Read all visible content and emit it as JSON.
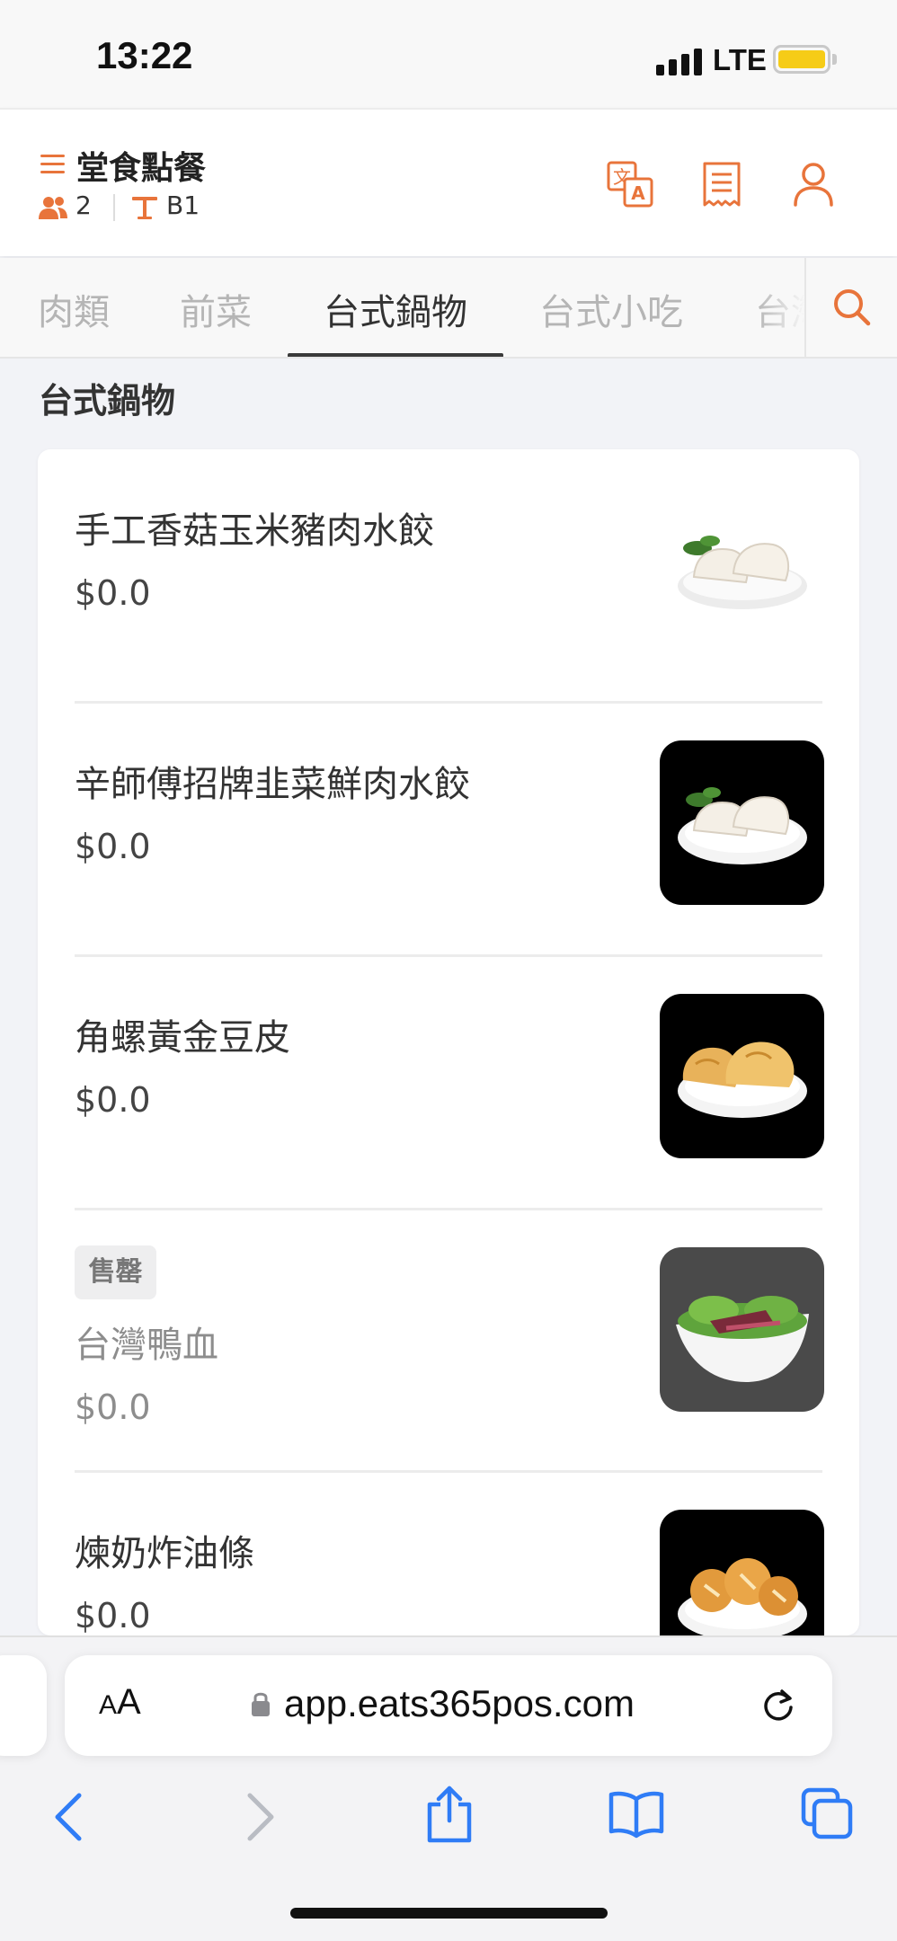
{
  "status_bar": {
    "time": "13:22",
    "network": "LTE"
  },
  "header": {
    "title": "堂食點餐",
    "guest_count": "2",
    "table_label": "B1"
  },
  "category_tabs": [
    "肉類",
    "前菜",
    "台式鍋物",
    "台式小吃",
    "台灣"
  ],
  "active_tab": "台式鍋物",
  "section": {
    "title": "台式鍋物"
  },
  "menu_items": [
    {
      "name": "手工香菇玉米豬肉水餃",
      "price": "$0.0",
      "image": "dumplings-photo",
      "sold_out": false
    },
    {
      "name": "辛師傅招牌韭菜鮮肉水餃",
      "price": "$0.0",
      "image": "dumplings-photo",
      "sold_out": false
    },
    {
      "name": "角螺黃金豆皮",
      "price": "$0.0",
      "image": "fried-tofu-skin-photo",
      "sold_out": false
    },
    {
      "name": "台灣鴨血",
      "price": "$0.0",
      "image": "duck-blood-photo",
      "sold_out": true,
      "badge": "售罄"
    },
    {
      "name": "煉奶炸油條",
      "price": "$0.0",
      "image": "fried-dough-photo",
      "sold_out": false
    }
  ],
  "browser": {
    "aa_small": "A",
    "aa_big": "A",
    "url": "app.eats365pos.com"
  },
  "colors": {
    "accent": "#e8743b",
    "background": "#f2f3f7",
    "battery": "#f6cc17"
  },
  "icons": [
    "menu-icon",
    "guests-icon",
    "table-icon",
    "translate-icon",
    "receipt-icon",
    "user-icon",
    "search-icon",
    "lock-icon",
    "reload-icon",
    "back-icon",
    "forward-icon",
    "share-icon",
    "bookmarks-icon",
    "tabs-icon"
  ]
}
